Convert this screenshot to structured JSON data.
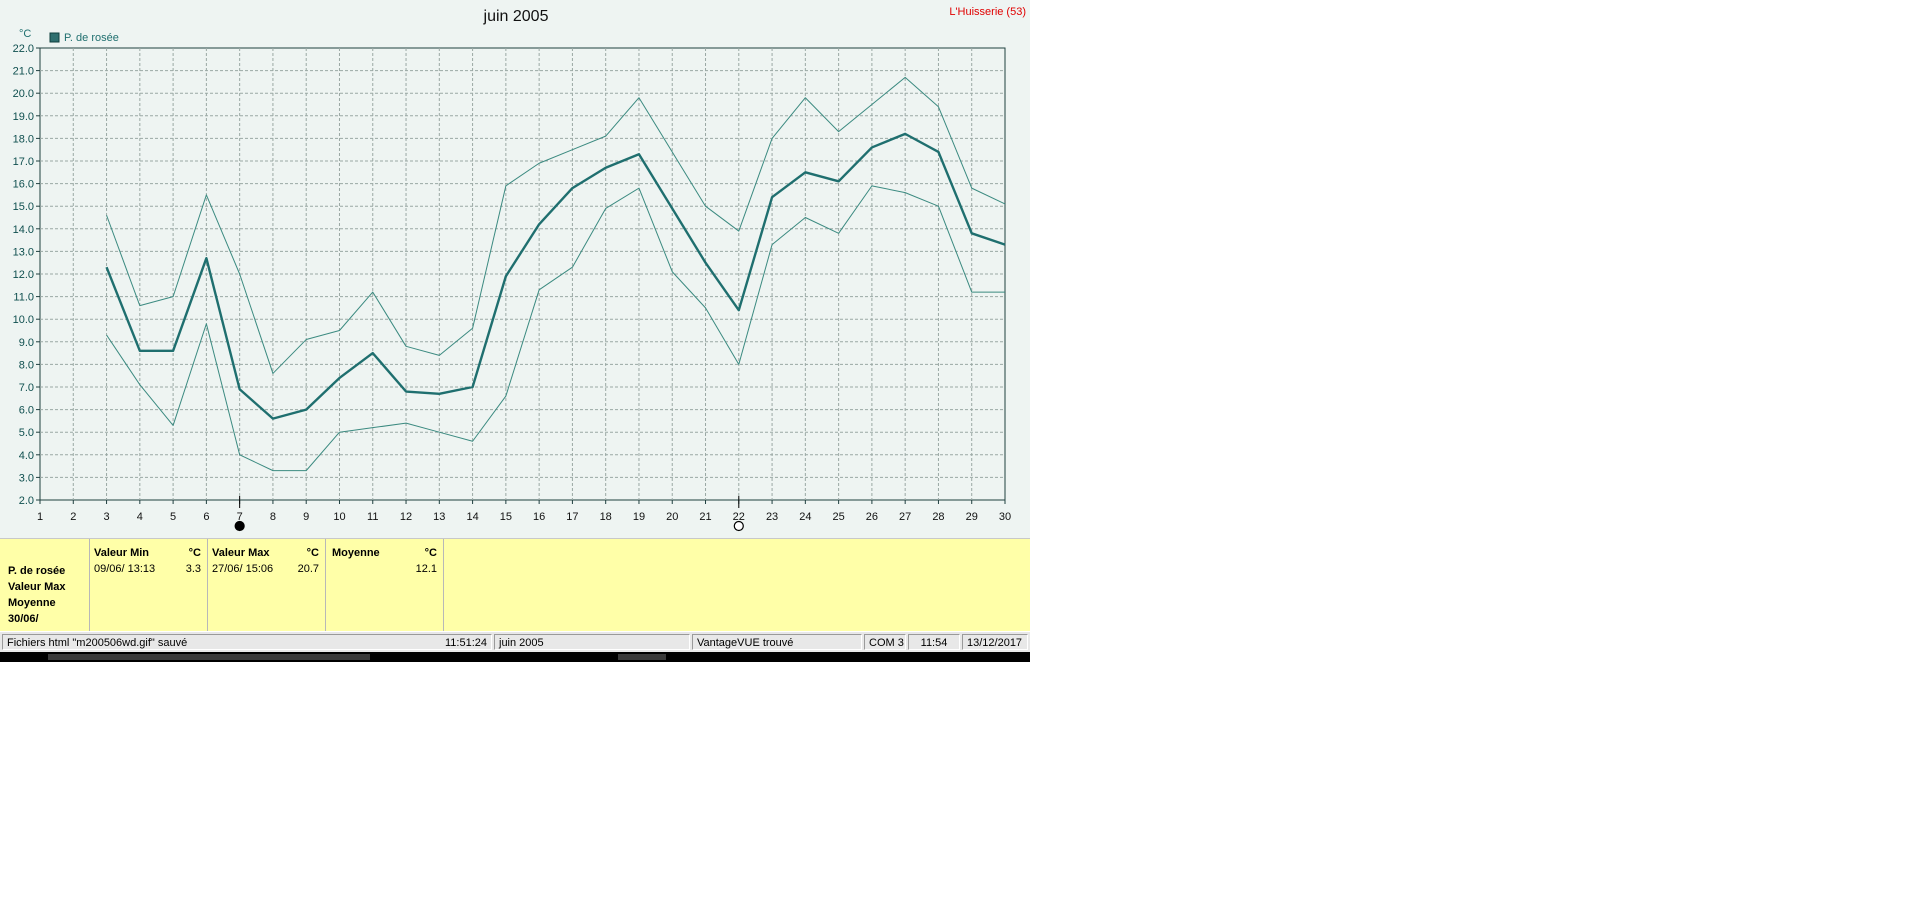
{
  "header": {
    "station": "L'Huisserie (53)"
  },
  "chart_data": {
    "type": "line",
    "title": "juin 2005",
    "ylabel": "°C",
    "ylim": [
      2.0,
      22.0
    ],
    "y_step": 1.0,
    "xlim": [
      1,
      30
    ],
    "grid": true,
    "legend": "top-left",
    "legend_label": "P. de rosée",
    "x_markers": [
      {
        "x": 7,
        "symbol": "filled-circle"
      },
      {
        "x": 22,
        "symbol": "open-circle"
      }
    ],
    "x": [
      3,
      4,
      5,
      6,
      7,
      8,
      9,
      10,
      11,
      12,
      13,
      14,
      15,
      16,
      17,
      18,
      19,
      20,
      21,
      22,
      23,
      24,
      25,
      26,
      27,
      28,
      29,
      30
    ],
    "series": [
      {
        "name": "P. de rosée",
        "role": "mean",
        "values": [
          12.3,
          8.6,
          8.6,
          12.7,
          6.9,
          5.6,
          6.0,
          7.4,
          8.5,
          6.8,
          6.7,
          7.0,
          11.9,
          14.2,
          15.8,
          16.7,
          17.3,
          14.9,
          12.5,
          10.4,
          15.4,
          16.5,
          16.1,
          17.6,
          18.2,
          17.4,
          13.8,
          13.3
        ]
      },
      {
        "name": "",
        "role": "max",
        "values": [
          14.6,
          10.6,
          11.0,
          15.5,
          12.0,
          7.6,
          9.1,
          9.5,
          11.2,
          8.8,
          8.4,
          9.6,
          15.9,
          16.9,
          17.5,
          18.1,
          19.8,
          17.4,
          15.0,
          13.9,
          18.0,
          19.8,
          18.3,
          19.5,
          20.7,
          19.4,
          15.8,
          15.1
        ]
      },
      {
        "name": "",
        "role": "min",
        "values": [
          9.3,
          7.1,
          5.3,
          9.8,
          4.0,
          3.3,
          3.3,
          5.0,
          5.2,
          5.4,
          5.0,
          4.6,
          6.6,
          11.3,
          12.3,
          14.9,
          15.8,
          12.1,
          10.5,
          8.0,
          13.3,
          14.5,
          13.8,
          15.9,
          15.6,
          15.0,
          11.2,
          11.2
        ]
      }
    ],
    "colors": {
      "mean": "#1f6f6f",
      "band": "#3b8a80",
      "axis": "#1f3f3f",
      "grid": "#9aa8a4",
      "legend_box": "#2f6f6f"
    }
  },
  "stats": {
    "row_labels": [
      "P. de rosée",
      "Valeur Max",
      "Moyenne",
      "30/06/"
    ],
    "min": {
      "header": "Valeur Min",
      "unit": "°C",
      "date": "09/06/  13:13",
      "value": "3.3"
    },
    "max": {
      "header": "Valeur Max",
      "unit": "°C",
      "date": "27/06/  15:06",
      "value": "20.7"
    },
    "avg": {
      "header": "Moyenne",
      "unit": "°C",
      "value": "12.1"
    }
  },
  "statusbar": {
    "message": "Fichiers html  \"m200506wd.gif\"  sauvé",
    "time_saved": "11:51:24",
    "period": "juin 2005",
    "device": "VantageVUE trouvé",
    "port": "COM 3",
    "clock": "11:54",
    "date": "13/12/2017"
  }
}
